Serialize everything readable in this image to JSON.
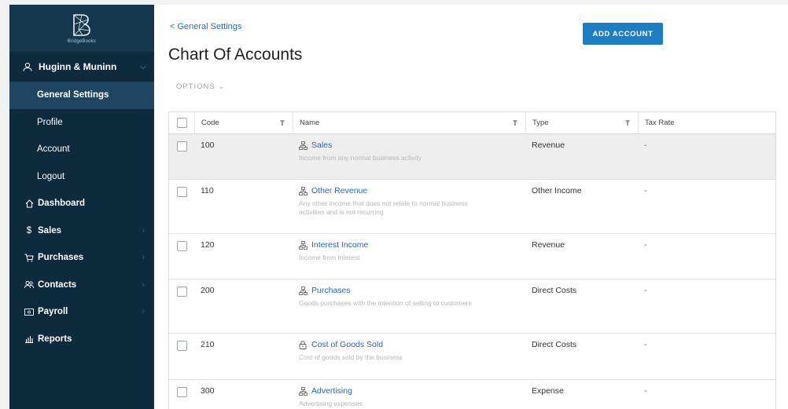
{
  "sidebar": {
    "logo_text": "BridgeBooks",
    "org_name": "Huginn & Muninn",
    "sub_items": [
      {
        "label": "General Settings",
        "active": true
      },
      {
        "label": "Profile",
        "active": false
      },
      {
        "label": "Account",
        "active": false
      },
      {
        "label": "Logout",
        "active": false
      }
    ],
    "nav_items": [
      {
        "label": "Dashboard",
        "icon": "home-icon",
        "glyph": "⌂",
        "has_chevron": false
      },
      {
        "label": "Sales",
        "icon": "dollar-icon",
        "glyph": "$",
        "has_chevron": true
      },
      {
        "label": "Purchases",
        "icon": "cart-icon",
        "glyph": "🛒",
        "has_chevron": true
      },
      {
        "label": "Contacts",
        "icon": "contacts-icon",
        "glyph": "👥",
        "has_chevron": true
      },
      {
        "label": "Payroll",
        "icon": "payroll-icon",
        "glyph": "▭",
        "has_chevron": true
      },
      {
        "label": "Reports",
        "icon": "bar-chart-icon",
        "glyph": "▥",
        "has_chevron": false
      }
    ]
  },
  "header": {
    "back_label": "< General Settings",
    "title": "Chart Of Accounts",
    "add_button": "ADD ACCOUNT",
    "options_label": "OPTIONS ⌄"
  },
  "table": {
    "columns": {
      "code": "Code",
      "name": "Name",
      "type": "Type",
      "tax": "Tax Rate"
    },
    "rows": [
      {
        "code": "100",
        "name": "Sales",
        "icon": "hierarchy-icon",
        "desc": "Income from any normal business activity",
        "type": "Revenue",
        "tax": "-",
        "height": 58,
        "selected": true
      },
      {
        "code": "110",
        "name": "Other Revenue",
        "icon": "hierarchy-icon",
        "desc": "Any other income that does not relate to normal business activities and is not recurring",
        "type": "Other Income",
        "tax": "-",
        "height": 69,
        "selected": false
      },
      {
        "code": "120",
        "name": "Interest Income",
        "icon": "hierarchy-icon",
        "desc": "Income from interest",
        "type": "Revenue",
        "tax": "-",
        "height": 58,
        "selected": false
      },
      {
        "code": "200",
        "name": "Purchases",
        "icon": "hierarchy-icon",
        "desc": "Goods purchases with the intention of selling to customers",
        "type": "Direct Costs",
        "tax": "-",
        "height": 69,
        "selected": false
      },
      {
        "code": "210",
        "name": "Cost of Goods Sold",
        "icon": "lock-icon",
        "desc": "Cost of goods sold by the business",
        "type": "Direct Costs",
        "tax": "-",
        "height": 59,
        "selected": false
      },
      {
        "code": "300",
        "name": "Advertising",
        "icon": "hierarchy-icon",
        "desc": "Advertising expenses",
        "type": "Expense",
        "tax": "-",
        "height": 58,
        "selected": false
      }
    ]
  },
  "colors": {
    "sidebar_bg": "#0e2a3d",
    "sidebar_active": "#1f4560",
    "accent": "#1f7ec1",
    "link": "#2b65a8"
  }
}
